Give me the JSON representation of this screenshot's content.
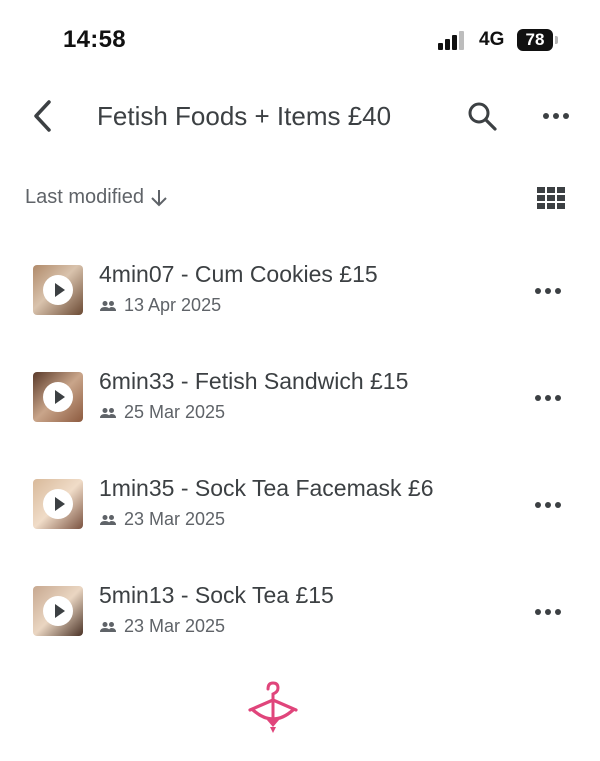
{
  "status_bar": {
    "time": "14:58",
    "network": "4G",
    "battery": "78"
  },
  "header": {
    "title": "Fetish Foods + Items £40",
    "back_icon": "chevron-left-icon",
    "search_icon": "search-icon",
    "more_icon": "more-horiz-icon"
  },
  "sort": {
    "label": "Last modified",
    "direction_icon": "arrow-down-icon",
    "view_icon": "grid-view-icon"
  },
  "files": [
    {
      "name": "4min07 - Cum Cookies £15",
      "date": "13 Apr 2025",
      "shared_icon": "people-icon"
    },
    {
      "name": "6min33 - Fetish Sandwich £15",
      "date": "25 Mar 2025",
      "shared_icon": "people-icon"
    },
    {
      "name": "1min35 - Sock Tea Facemask £6",
      "date": "23 Mar 2025",
      "shared_icon": "people-icon"
    },
    {
      "name": "5min13 - Sock Tea £15",
      "date": "23 Mar 2025",
      "shared_icon": "people-icon"
    }
  ],
  "colors": {
    "accent": "#e0457b",
    "text": "#3c4043",
    "secondary": "#5f6368"
  }
}
